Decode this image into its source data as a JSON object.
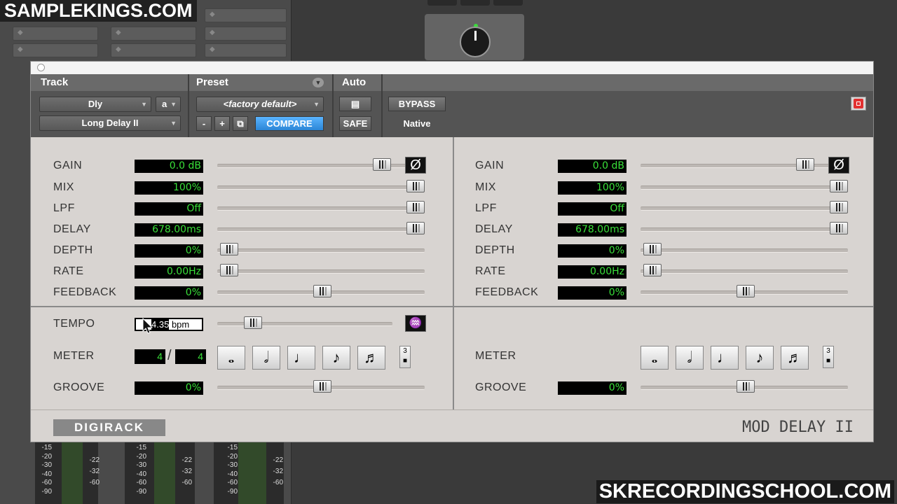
{
  "watermarks": {
    "top_left": "SAMPLEKINGS.COM",
    "bottom_right": "SKRECORDINGSCHOOL.COM"
  },
  "background": {
    "meter_scale": [
      "-15",
      "-20",
      "-30",
      "-40",
      "-60",
      "-90"
    ],
    "meter_scale_right": [
      "-22",
      "-32",
      "-60"
    ]
  },
  "header": {
    "track_label": "Track",
    "preset_label": "Preset",
    "auto_label": "Auto",
    "track_name": "Dly",
    "channel": "a",
    "plugin_name": "Long Delay II",
    "preset_name": "<factory default>",
    "minus": "-",
    "plus": "+",
    "compare": "COMPARE",
    "safe": "SAFE",
    "bypass": "BYPASS",
    "native": "Native"
  },
  "left": {
    "gain": {
      "label": "GAIN",
      "value": "0.0 dB"
    },
    "mix": {
      "label": "MIX",
      "value": "100%"
    },
    "lpf": {
      "label": "LPF",
      "value": "Off"
    },
    "delay": {
      "label": "DELAY",
      "value": "678.00ms"
    },
    "depth": {
      "label": "DEPTH",
      "value": "0%"
    },
    "rate": {
      "label": "RATE",
      "value": "0.00Hz"
    },
    "feedback": {
      "label": "FEEDBACK",
      "value": "0%"
    },
    "tempo": {
      "label": "TEMPO",
      "value": "4.35",
      "unit": "bpm"
    },
    "meter": {
      "label": "METER",
      "numerator": "4",
      "denominator": "4"
    },
    "groove": {
      "label": "GROOVE",
      "value": "0%"
    }
  },
  "right": {
    "gain": {
      "label": "GAIN",
      "value": "0.0 dB"
    },
    "mix": {
      "label": "MIX",
      "value": "100%"
    },
    "lpf": {
      "label": "LPF",
      "value": "Off"
    },
    "delay": {
      "label": "DELAY",
      "value": "678.00ms"
    },
    "depth": {
      "label": "DEPTH",
      "value": "0%"
    },
    "rate": {
      "label": "RATE",
      "value": "0.00Hz"
    },
    "feedback": {
      "label": "FEEDBACK",
      "value": "0%"
    },
    "meter": {
      "label": "METER"
    },
    "groove": {
      "label": "GROOVE",
      "value": "0%"
    }
  },
  "icons": {
    "phase": "Ø",
    "whole_note": "𝅝",
    "half_note": "𝅗𝅥",
    "quarter_note": "♩",
    "eighth_note": "♪",
    "sixteenth_note": "♬",
    "triplet": "3",
    "metronome": "♒"
  },
  "footer": {
    "logo": "DIGIRACK",
    "brand": "MOD DELAY II"
  },
  "colors": {
    "display_green": "#39e039",
    "compare_blue": "#2b86d6",
    "close_red": "#e23030"
  }
}
